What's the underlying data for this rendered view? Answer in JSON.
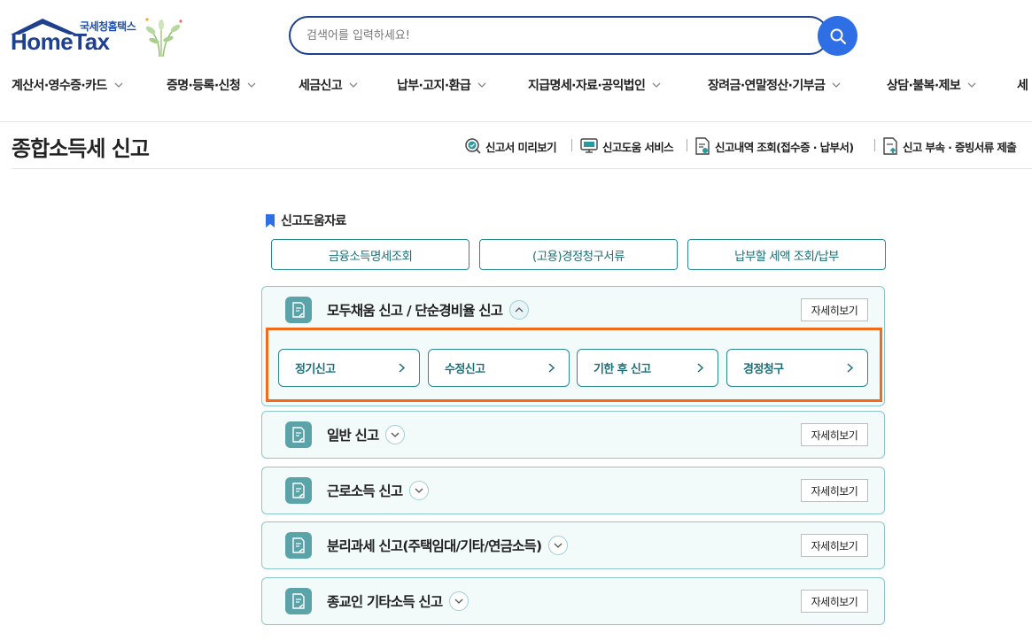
{
  "header": {
    "logo_sub": "국세청홈택스",
    "logo_text": "HomeTax",
    "search_placeholder": "검색어를 입력하세요!"
  },
  "gnb": [
    {
      "label": "계산서·영수증·카드"
    },
    {
      "label": "증명·등록·신청"
    },
    {
      "label": "세금신고"
    },
    {
      "label": "납부·고지·환급"
    },
    {
      "label": "지급명세·자료·공익법인"
    },
    {
      "label": "장려금·연말정산·기부금"
    },
    {
      "label": "상담·불복·제보"
    },
    {
      "label": "세"
    }
  ],
  "page_title": "종합소득세 신고",
  "quick_links": [
    {
      "label": "신고서 미리보기",
      "icon": "magnifier-check-icon"
    },
    {
      "label": "신고도움 서비스",
      "icon": "monitor-help-icon"
    },
    {
      "label": "신고내역 조회(접수증 · 납부서)",
      "icon": "document-search-icon"
    },
    {
      "label": "신고 부속 · 증빙서류 제출",
      "icon": "document-upload-icon"
    }
  ],
  "help": {
    "title": "신고도움자료",
    "buttons": [
      "금융소득명세조회",
      "(고용)경정청구서류",
      "납부할 세액 조회/납부"
    ]
  },
  "panels": [
    {
      "title": "모두채움 신고 / 단순경비율 신고",
      "detail": "자세히보기",
      "open": true,
      "sub_buttons": [
        "정기신고",
        "수정신고",
        "기한 후 신고",
        "경정청구"
      ]
    },
    {
      "title": "일반 신고",
      "detail": "자세히보기",
      "open": false
    },
    {
      "title": "근로소득 신고",
      "detail": "자세히보기",
      "open": false
    },
    {
      "title": "분리과세 신고(주택임대/기타/연금소득)",
      "detail": "자세히보기",
      "open": false
    },
    {
      "title": "종교인 기타소득 신고",
      "detail": "자세히보기",
      "open": false
    }
  ],
  "colors": {
    "brand_navy": "#1f3f8f",
    "search_button": "#2f6fe6",
    "teal_border": "#2a8a94",
    "teal_text": "#1c6f78",
    "panel_bg": "#f2fafa",
    "highlight": "#f26a1b"
  }
}
